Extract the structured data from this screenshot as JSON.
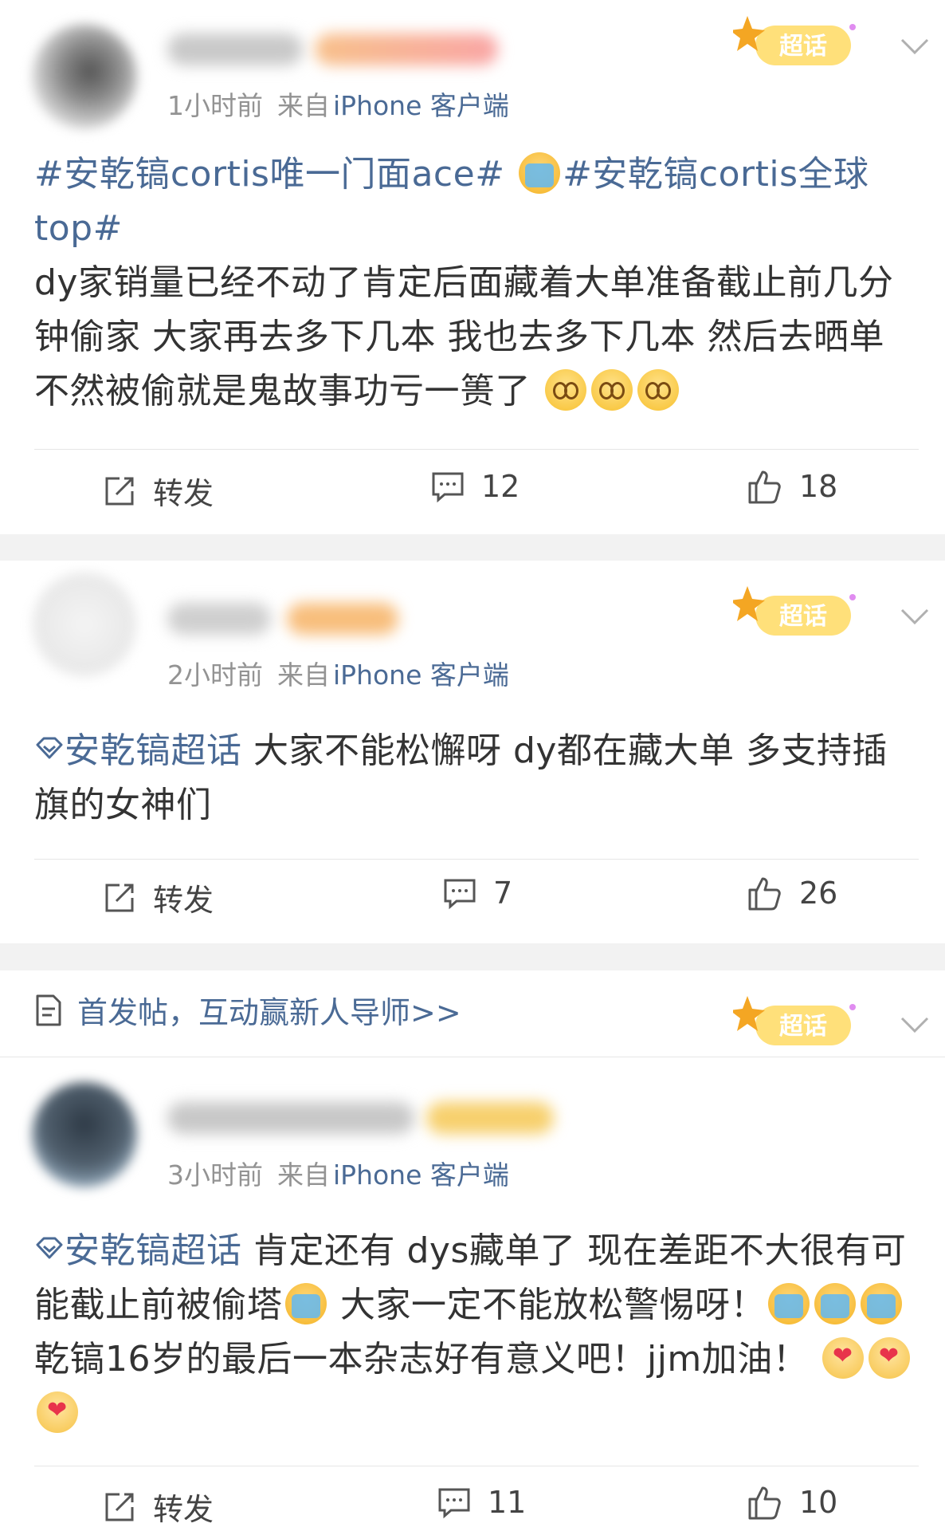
{
  "badge_label": "超话",
  "actions_repost_label": "转发",
  "notice": {
    "text": "首发帖，互动赢新人导师>>"
  },
  "posts": [
    {
      "time": "1小时前",
      "source_prefix": "来自",
      "device": "iPhone 客户端",
      "topic_1": "#安乾镐cortis唯一门面ace#",
      "topic_2": "#安乾镐cortis全球top#",
      "body": "dy家销量已经不动了肯定后面藏着大单准备截止前几分钟偷家 大家再去多下几本 我也去多下几本 然后去晒单 不然被偷就是鬼故事功亏一篑了",
      "comments": "12",
      "likes": "18"
    },
    {
      "time": "2小时前",
      "source_prefix": "来自",
      "device": "iPhone 客户端",
      "topic": "安乾镐超话",
      "body": " 大家不能松懈呀 dy都在藏大单 多支持插旗的女神们",
      "comments": "7",
      "likes": "26"
    },
    {
      "time": "3小时前",
      "source_prefix": "来自",
      "device": "iPhone 客户端",
      "topic": "安乾镐超话",
      "body_a": " 肯定还有 dys藏单了 现在差距不大很有可能截止前被偷塔",
      "body_b": " 大家一定不能放松警惕呀！",
      "body_c": "乾镐16岁的最后一本杂志好有意义吧！jjm加油！",
      "comments": "11",
      "likes": "10"
    }
  ],
  "colors": {
    "link": "#4a6a95",
    "meta": "#939393",
    "separator": "#f2f2f2"
  }
}
